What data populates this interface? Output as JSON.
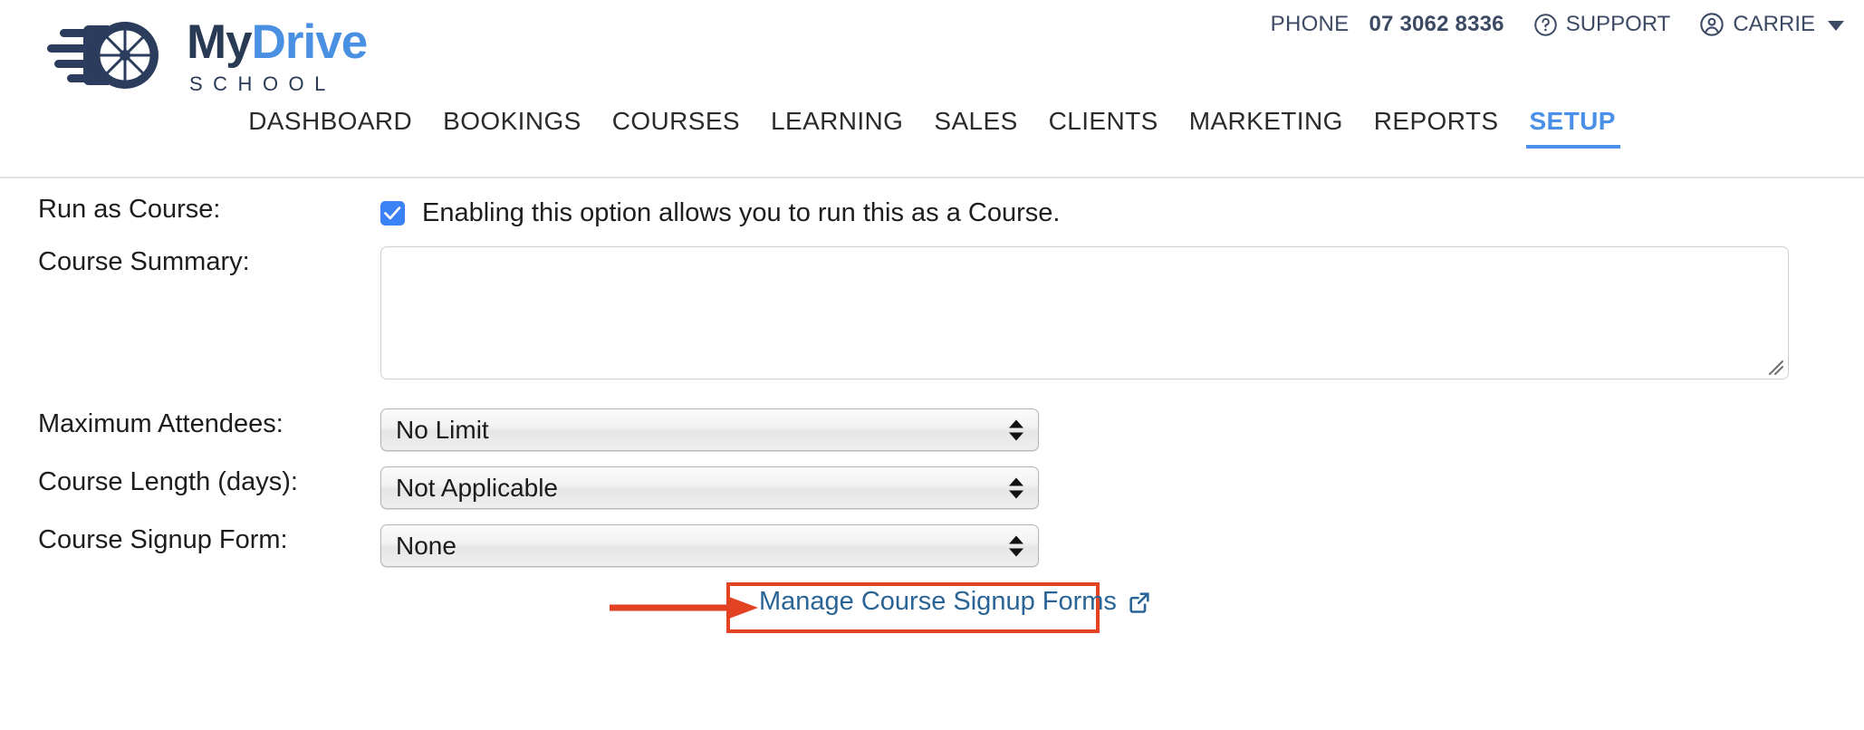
{
  "brand": {
    "logo_icon": "wheel-speed-icon",
    "name_part1": "My",
    "name_part2": "Drive",
    "subtitle": "SCHOOL",
    "color_dark": "#293a55",
    "color_blue": "#4a90e2"
  },
  "topbar": {
    "phone_label": "PHONE",
    "phone_number": "07 3062 8336",
    "support_label": "SUPPORT",
    "support_icon": "question-circle-icon",
    "user_label": "CARRIE",
    "user_icon": "user-circle-icon",
    "caret_icon": "chevron-down-icon",
    "color": "#3c4a63"
  },
  "nav": {
    "items": [
      {
        "label": "DASHBOARD",
        "active": false
      },
      {
        "label": "BOOKINGS",
        "active": false
      },
      {
        "label": "COURSES",
        "active": false
      },
      {
        "label": "LEARNING",
        "active": false
      },
      {
        "label": "SALES",
        "active": false
      },
      {
        "label": "CLIENTS",
        "active": false
      },
      {
        "label": "MARKETING",
        "active": false
      },
      {
        "label": "REPORTS",
        "active": false
      },
      {
        "label": "SETUP",
        "active": true
      }
    ],
    "active_color": "#4a90e8"
  },
  "form": {
    "run_as_course": {
      "label": "Run as Course:",
      "checked": true,
      "checkbox_color": "#3b82f6",
      "description": "Enabling this option allows you to run this as a Course."
    },
    "course_summary": {
      "label": "Course Summary:",
      "value": "",
      "placeholder": ""
    },
    "maximum_attendees": {
      "label": "Maximum Attendees:",
      "value": "No Limit"
    },
    "course_length": {
      "label": "Course Length (days):",
      "value": "Not Applicable"
    },
    "course_signup_form": {
      "label": "Course Signup Form:",
      "value": "None"
    },
    "manage_link": {
      "label": "Manage Course Signup Forms",
      "icon": "external-link-icon",
      "color": "#2a6496"
    }
  },
  "annotation": {
    "color": "#e34323",
    "box_target": "manage-course-signup-forms-link",
    "arrow_icon": "arrow-right-icon"
  }
}
